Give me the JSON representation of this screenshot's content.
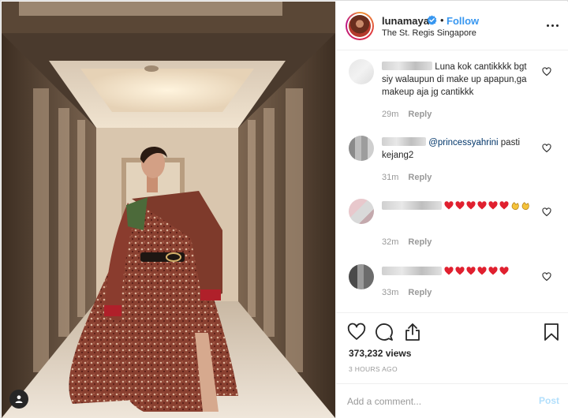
{
  "header": {
    "username": "lunamaya",
    "follow_label": "Follow",
    "separator": "•",
    "location": "The St. Regis Singapore",
    "more_icon": "more-horizontal-icon"
  },
  "comments": [
    {
      "text": "Luna kok cantikkkk bgt siy walaupun di make up apapun,ga makeup aja jg cantikkk",
      "time": "29m",
      "reply_label": "Reply"
    },
    {
      "mention": "@princessyahrini",
      "text": " pasti kejang2",
      "time": "31m",
      "reply_label": "Reply"
    },
    {
      "emoji": [
        "heart",
        "heart",
        "heart",
        "heart",
        "heart",
        "heart",
        "clap",
        "clap"
      ],
      "time": "32m",
      "reply_label": "Reply"
    },
    {
      "emoji": [
        "heart",
        "heart",
        "heart",
        "heart",
        "heart",
        "heart"
      ],
      "time": "33m",
      "reply_label": "Reply"
    }
  ],
  "actions": {
    "views": "373,232 views",
    "posted_ago": "3 HOURS AGO",
    "icons": [
      "heart-icon",
      "comment-icon",
      "share-icon",
      "bookmark-icon"
    ]
  },
  "composer": {
    "placeholder": "Add a comment...",
    "post_label": "Post"
  },
  "colors": {
    "link_blue": "#3897f0",
    "mention_blue": "#003569",
    "emoji_red": "#e0202f",
    "post_disabled": "#b2dffc",
    "muted": "#999999"
  }
}
